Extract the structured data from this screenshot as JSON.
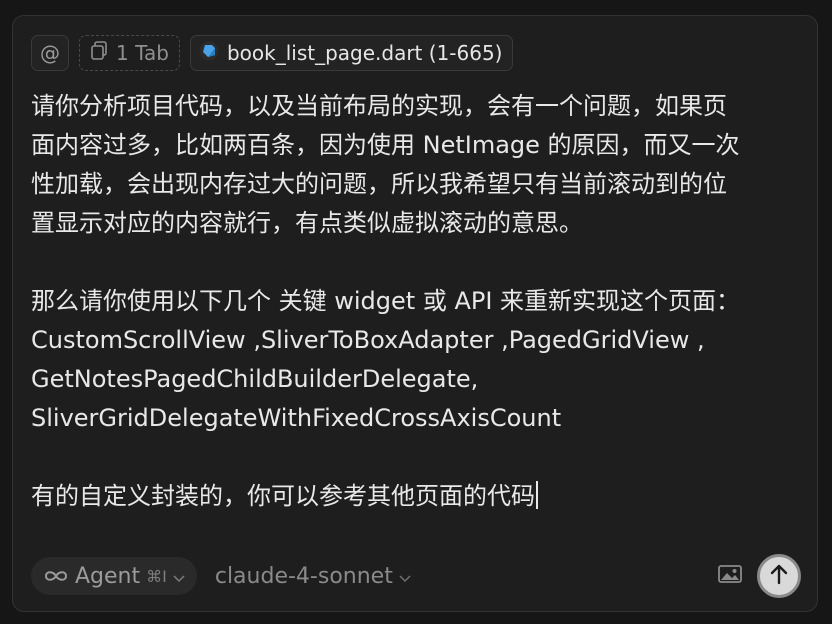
{
  "context_chips": {
    "mention_symbol": "@",
    "tab_label": "1 Tab",
    "file_label": "book_list_page.dart (1-665)",
    "file_icon": "dart-icon"
  },
  "prompt": {
    "lines": [
      "请你分析项目代码，以及当前布局的实现，会有一个问题，如果页",
      "面内容过多，比如两百条，因为使用 NetImage 的原因，而又一次",
      "性加载，会出现内存过大的问题，所以我希望只有当前滚动到的位",
      "置显示对应的内容就行，有点类似虚拟滚动的意思。",
      "",
      "那么请你使用以下几个 关键 widget 或 API 来重新实现这个页面：",
      "CustomScrollView ,SliverToBoxAdapter ,PagedGridView ,",
      "GetNotesPagedChildBuilderDelegate,",
      "SliverGridDelegateWithFixedCrossAxisCount",
      "",
      "有的自定义封装的，你可以参考其他页面的代码"
    ]
  },
  "composer": {
    "mode_label": "Agent",
    "mode_shortcut": "⌘I",
    "model_label": "claude-4-sonnet"
  },
  "colors": {
    "background": "#161616",
    "panel": "#1e1e1e",
    "text": "#e8e8e8",
    "dart_blue": "#4aa3e8"
  }
}
